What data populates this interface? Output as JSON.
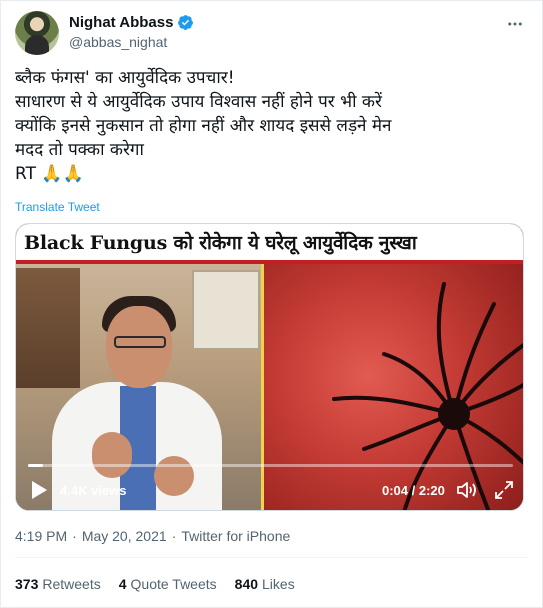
{
  "author": {
    "display_name": "Nighat Abbass",
    "handle": "@abbas_nighat",
    "verified": true
  },
  "tweet": {
    "lines": [
      "ब्लैक फंगस' का आयुर्वेदिक उपचार!",
      "साधारण से ये आयुर्वेदिक उपाय विश्वास नहीं होने पर भी करें",
      "क्योंकि इनसे नुकसान तो होगा नहीं और शायद इससे लड़ने मेन",
      "मदद तो पक्का करेगा"
    ],
    "rt_text": "RT",
    "emoji": "🙏🙏",
    "translate_label": "Translate Tweet"
  },
  "video": {
    "banner_title": "Black Fungus को रोकेगा ये घरेलू आयुर्वेदिक नुस्खा",
    "views": "4.4K views",
    "time": "0:04 / 2:20",
    "progress": 0.03
  },
  "meta": {
    "time": "4:19 PM",
    "dot1": "·",
    "date": "May 20, 2021",
    "dot2": "·",
    "source": "Twitter for iPhone"
  },
  "stats": {
    "retweets_count": "373",
    "retweets_label": "Retweets",
    "quotes_count": "4",
    "quotes_label": "Quote Tweets",
    "likes_count": "840",
    "likes_label": "Likes"
  },
  "colors": {
    "link": "#1d9bf0",
    "verified": "#1d9bf0",
    "banner_accent": "#c31e24"
  }
}
